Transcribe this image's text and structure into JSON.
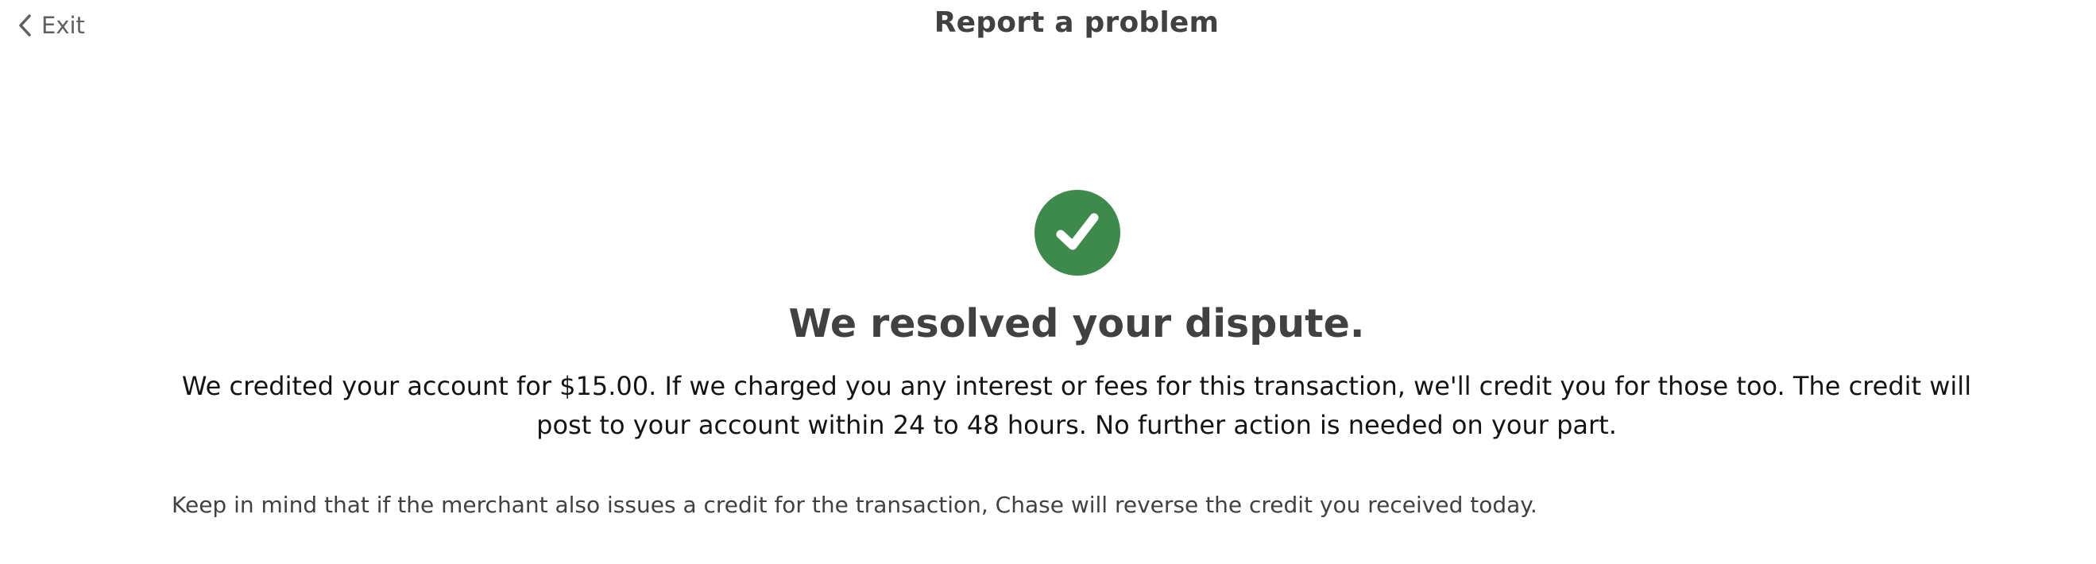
{
  "header": {
    "exit_label": "Exit",
    "title": "Report a problem"
  },
  "icons": {
    "back": "chevron-left-icon",
    "status": "check-circle-icon"
  },
  "colors": {
    "success_green": "#3e8a4c",
    "text_dark": "#414042",
    "body_text": "#141414"
  },
  "main": {
    "headline": "We resolved your dispute.",
    "message": "We credited your account for $15.00. If we charged you any interest or fees for this transaction, we'll credit you for those too. The credit will post to your account within 24 to 48 hours. No further action is needed on your part.",
    "note": "Keep in mind that if the merchant also issues a credit for the transaction, Chase will reverse the credit you received today."
  }
}
